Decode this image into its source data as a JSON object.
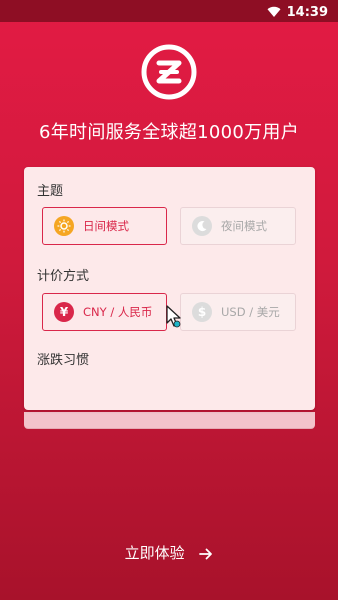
{
  "status": {
    "time": "14:39",
    "wifi_icon": "wifi-icon"
  },
  "header": {
    "tagline": "6年时间服务全球超1000万用户",
    "logo_icon": "zb-logo-icon"
  },
  "card": {
    "theme": {
      "title": "主题",
      "day": {
        "label": "日间模式",
        "icon": "sun-icon",
        "selected": true
      },
      "night": {
        "label": "夜间模式",
        "icon": "moon-icon",
        "selected": false
      }
    },
    "pricing": {
      "title": "计价方式",
      "cny": {
        "label": "CNY / 人民币",
        "icon": "yen-icon",
        "selected": true
      },
      "usd": {
        "label": "USD / 美元",
        "icon": "dollar-icon",
        "selected": false
      }
    },
    "habit": {
      "title": "涨跌习惯"
    }
  },
  "footer": {
    "cta_label": "立即体验",
    "arrow_icon": "arrow-right-icon"
  },
  "colors": {
    "accent": "#d9274a",
    "background_top": "#e31b44",
    "background_bottom": "#a8122b",
    "card": "#fde9ea"
  }
}
